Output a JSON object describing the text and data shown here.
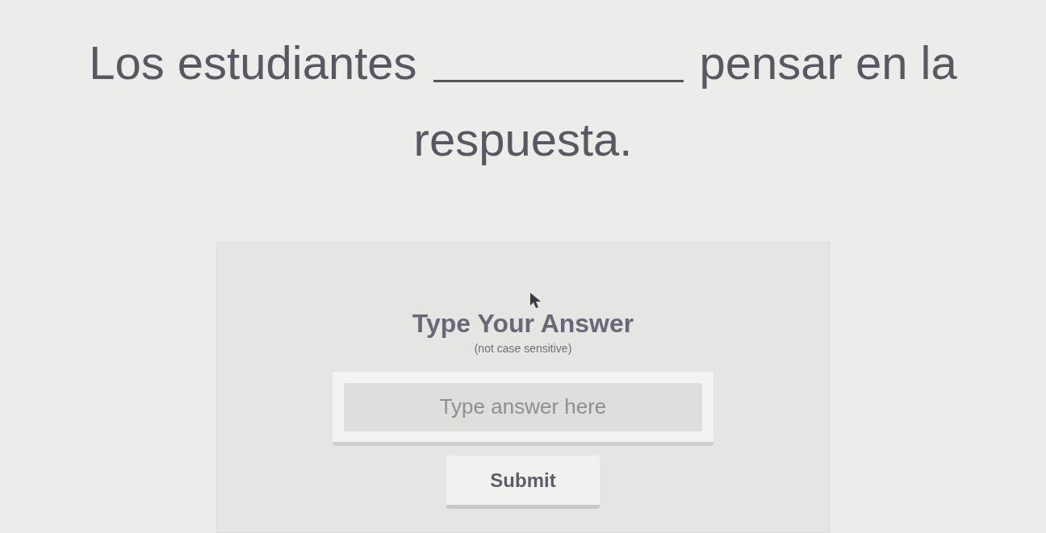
{
  "question": {
    "lines": [
      [
        {
          "kind": "text",
          "text": "Los estudiantes"
        },
        {
          "kind": "blank"
        },
        {
          "kind": "text",
          "text": "pensar en la"
        }
      ],
      [
        {
          "kind": "text",
          "text": "respuesta."
        }
      ]
    ]
  },
  "answer_card": {
    "title": "Type Your Answer",
    "subtitle": "(not case sensitive)",
    "input": {
      "placeholder": "Type answer here"
    },
    "submit_label": "Submit"
  }
}
